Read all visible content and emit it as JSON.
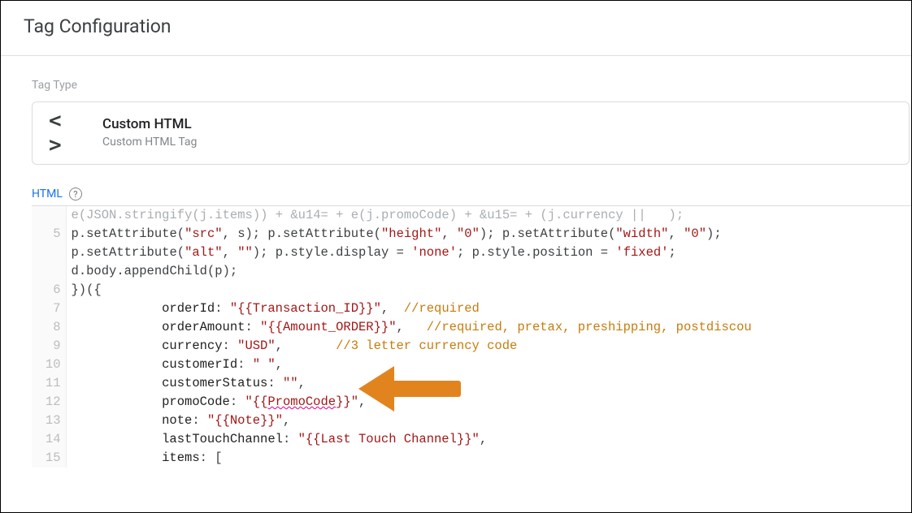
{
  "header": {
    "title": "Tag Configuration"
  },
  "tag_type": {
    "section_label": "Tag Type",
    "icon_glyph": "< >",
    "title": "Custom HTML",
    "subtitle": "Custom HTML Tag"
  },
  "editor": {
    "label": "HTML",
    "help_glyph": "?",
    "lines": [
      {
        "num": "",
        "row": "r_top"
      },
      {
        "num": "5",
        "row": "r5a"
      },
      {
        "num": "",
        "row": "r5b"
      },
      {
        "num": "",
        "row": "r5c"
      },
      {
        "num": "6",
        "row": "r6"
      },
      {
        "num": "7",
        "row": "r7"
      },
      {
        "num": "8",
        "row": "r8"
      },
      {
        "num": "9",
        "row": "r9"
      },
      {
        "num": "10",
        "row": "r10"
      },
      {
        "num": "11",
        "row": "r11"
      },
      {
        "num": "12",
        "row": "r12"
      },
      {
        "num": "13",
        "row": "r13"
      },
      {
        "num": "14",
        "row": "r14"
      },
      {
        "num": "15",
        "row": "r15"
      }
    ],
    "tokens": {
      "r_top": [
        {
          "t": "e",
          "c": "tok-id truncated-top"
        },
        {
          "t": "(",
          "c": "tok-pn truncated-top"
        },
        {
          "t": "JSON",
          "c": "tok-id truncated-top"
        },
        {
          "t": ".",
          "c": "tok-pn truncated-top"
        },
        {
          "t": "stringify",
          "c": "tok-id truncated-top"
        },
        {
          "t": "(",
          "c": "tok-pn truncated-top"
        },
        {
          "t": "j",
          "c": "tok-id truncated-top"
        },
        {
          "t": ".",
          "c": "tok-pn truncated-top"
        },
        {
          "t": "items",
          "c": "tok-id truncated-top"
        },
        {
          "t": ")) + ",
          "c": "tok-pn truncated-top"
        },
        {
          "t": "&u14=",
          "c": "tok-str truncated-top"
        },
        {
          "t": " + ",
          "c": "tok-pn truncated-top"
        },
        {
          "t": "e",
          "c": "tok-id truncated-top"
        },
        {
          "t": "(",
          "c": "tok-pn truncated-top"
        },
        {
          "t": "j",
          "c": "tok-id truncated-top"
        },
        {
          "t": ".",
          "c": "tok-pn truncated-top"
        },
        {
          "t": "promoCode",
          "c": "tok-id truncated-top"
        },
        {
          "t": ") + ",
          "c": "tok-pn truncated-top"
        },
        {
          "t": "&u15=",
          "c": "tok-str truncated-top"
        },
        {
          "t": " + (",
          "c": "tok-pn truncated-top"
        },
        {
          "t": "j",
          "c": "tok-id truncated-top"
        },
        {
          "t": ".",
          "c": "tok-pn truncated-top"
        },
        {
          "t": "currency",
          "c": "tok-id truncated-top"
        },
        {
          "t": " ||   );",
          "c": "tok-pn truncated-top"
        }
      ],
      "r5a": [
        {
          "t": "p",
          "c": "tok-id"
        },
        {
          "t": ".",
          "c": "tok-pn"
        },
        {
          "t": "setAttribute",
          "c": "tok-id"
        },
        {
          "t": "(",
          "c": "tok-pn"
        },
        {
          "t": "\"src\"",
          "c": "tok-str"
        },
        {
          "t": ", ",
          "c": "tok-pn"
        },
        {
          "t": "s",
          "c": "tok-id"
        },
        {
          "t": "); ",
          "c": "tok-pn"
        },
        {
          "t": "p",
          "c": "tok-id"
        },
        {
          "t": ".",
          "c": "tok-pn"
        },
        {
          "t": "setAttribute",
          "c": "tok-id"
        },
        {
          "t": "(",
          "c": "tok-pn"
        },
        {
          "t": "\"height\"",
          "c": "tok-str"
        },
        {
          "t": ", ",
          "c": "tok-pn"
        },
        {
          "t": "\"0\"",
          "c": "tok-str"
        },
        {
          "t": "); ",
          "c": "tok-pn"
        },
        {
          "t": "p",
          "c": "tok-id"
        },
        {
          "t": ".",
          "c": "tok-pn"
        },
        {
          "t": "setAttribute",
          "c": "tok-id"
        },
        {
          "t": "(",
          "c": "tok-pn"
        },
        {
          "t": "\"width\"",
          "c": "tok-str"
        },
        {
          "t": ", ",
          "c": "tok-pn"
        },
        {
          "t": "\"0\"",
          "c": "tok-str"
        },
        {
          "t": ");",
          "c": "tok-pn"
        }
      ],
      "r5b": [
        {
          "t": "p",
          "c": "tok-id"
        },
        {
          "t": ".",
          "c": "tok-pn"
        },
        {
          "t": "setAttribute",
          "c": "tok-id"
        },
        {
          "t": "(",
          "c": "tok-pn"
        },
        {
          "t": "\"alt\"",
          "c": "tok-str"
        },
        {
          "t": ", ",
          "c": "tok-pn"
        },
        {
          "t": "\"\"",
          "c": "tok-str"
        },
        {
          "t": "); ",
          "c": "tok-pn"
        },
        {
          "t": "p",
          "c": "tok-id"
        },
        {
          "t": ".",
          "c": "tok-pn"
        },
        {
          "t": "style",
          "c": "tok-id"
        },
        {
          "t": ".",
          "c": "tok-pn"
        },
        {
          "t": "display",
          "c": "tok-id"
        },
        {
          "t": " = ",
          "c": "tok-pn"
        },
        {
          "t": "'none'",
          "c": "tok-str"
        },
        {
          "t": "; ",
          "c": "tok-pn"
        },
        {
          "t": "p",
          "c": "tok-id"
        },
        {
          "t": ".",
          "c": "tok-pn"
        },
        {
          "t": "style",
          "c": "tok-id"
        },
        {
          "t": ".",
          "c": "tok-pn"
        },
        {
          "t": "position",
          "c": "tok-id"
        },
        {
          "t": " = ",
          "c": "tok-pn"
        },
        {
          "t": "'fixed'",
          "c": "tok-str"
        },
        {
          "t": ";",
          "c": "tok-pn"
        }
      ],
      "r5c": [
        {
          "t": "d",
          "c": "tok-id"
        },
        {
          "t": ".",
          "c": "tok-pn"
        },
        {
          "t": "body",
          "c": "tok-id"
        },
        {
          "t": ".",
          "c": "tok-pn"
        },
        {
          "t": "appendChild",
          "c": "tok-id"
        },
        {
          "t": "(",
          "c": "tok-pn"
        },
        {
          "t": "p",
          "c": "tok-id"
        },
        {
          "t": ");",
          "c": "tok-pn"
        }
      ],
      "r6": [
        {
          "t": "})({",
          "c": "tok-pn"
        }
      ],
      "r7": [
        {
          "t": "            ",
          "c": "tok-pn"
        },
        {
          "t": "orderId",
          "c": "tok-prop"
        },
        {
          "t": ": ",
          "c": "tok-pn"
        },
        {
          "t": "\"",
          "c": "tok-str"
        },
        {
          "t": "{{Transaction_ID}}",
          "c": "tok-var"
        },
        {
          "t": "\"",
          "c": "tok-str"
        },
        {
          "t": ",  ",
          "c": "tok-pn"
        },
        {
          "t": "//required",
          "c": "tok-cmt"
        }
      ],
      "r8": [
        {
          "t": "            ",
          "c": "tok-pn"
        },
        {
          "t": "orderAmount",
          "c": "tok-prop"
        },
        {
          "t": ": ",
          "c": "tok-pn"
        },
        {
          "t": "\"",
          "c": "tok-str"
        },
        {
          "t": "{{Amount_ORDER}}",
          "c": "tok-var"
        },
        {
          "t": "\"",
          "c": "tok-str"
        },
        {
          "t": ",   ",
          "c": "tok-pn"
        },
        {
          "t": "//required, pretax, preshipping, postdiscou",
          "c": "tok-cmt"
        }
      ],
      "r9": [
        {
          "t": "            ",
          "c": "tok-pn"
        },
        {
          "t": "currency",
          "c": "tok-prop"
        },
        {
          "t": ": ",
          "c": "tok-pn"
        },
        {
          "t": "\"USD\"",
          "c": "tok-str"
        },
        {
          "t": ",       ",
          "c": "tok-pn"
        },
        {
          "t": "//3 letter currency code",
          "c": "tok-cmt"
        }
      ],
      "r10": [
        {
          "t": "            ",
          "c": "tok-pn"
        },
        {
          "t": "customerId",
          "c": "tok-prop"
        },
        {
          "t": ": ",
          "c": "tok-pn"
        },
        {
          "t": "\" \"",
          "c": "tok-str"
        },
        {
          "t": ",",
          "c": "tok-pn"
        }
      ],
      "r11": [
        {
          "t": "            ",
          "c": "tok-pn"
        },
        {
          "t": "customerStatus",
          "c": "tok-prop"
        },
        {
          "t": ": ",
          "c": "tok-pn"
        },
        {
          "t": "\"\"",
          "c": "tok-str"
        },
        {
          "t": ",",
          "c": "tok-pn"
        }
      ],
      "r12": [
        {
          "t": "            ",
          "c": "tok-pn"
        },
        {
          "t": "promoCode",
          "c": "tok-prop"
        },
        {
          "t": ": ",
          "c": "tok-pn"
        },
        {
          "t": "\"",
          "c": "tok-str"
        },
        {
          "t": "{{",
          "c": "tok-var"
        },
        {
          "t": "PromoCode",
          "c": "tok-var underline-wavy"
        },
        {
          "t": "}}",
          "c": "tok-var"
        },
        {
          "t": "\"",
          "c": "tok-str"
        },
        {
          "t": ",",
          "c": "tok-pn"
        }
      ],
      "r13": [
        {
          "t": "            ",
          "c": "tok-pn"
        },
        {
          "t": "note",
          "c": "tok-prop"
        },
        {
          "t": ": ",
          "c": "tok-pn"
        },
        {
          "t": "\"",
          "c": "tok-str"
        },
        {
          "t": "{{Note}}",
          "c": "tok-var"
        },
        {
          "t": "\"",
          "c": "tok-str"
        },
        {
          "t": ",",
          "c": "tok-pn"
        }
      ],
      "r14": [
        {
          "t": "            ",
          "c": "tok-pn"
        },
        {
          "t": "lastTouchChannel",
          "c": "tok-prop"
        },
        {
          "t": ": ",
          "c": "tok-pn"
        },
        {
          "t": "\"",
          "c": "tok-str"
        },
        {
          "t": "{{Last Touch Channel}}",
          "c": "tok-var"
        },
        {
          "t": "\"",
          "c": "tok-str"
        },
        {
          "t": ",",
          "c": "tok-pn"
        }
      ],
      "r15": [
        {
          "t": "            ",
          "c": "tok-pn"
        },
        {
          "t": "items",
          "c": "tok-prop"
        },
        {
          "t": ": [",
          "c": "tok-pn"
        }
      ]
    }
  },
  "annotation": {
    "arrow_color": "#e2841e"
  }
}
